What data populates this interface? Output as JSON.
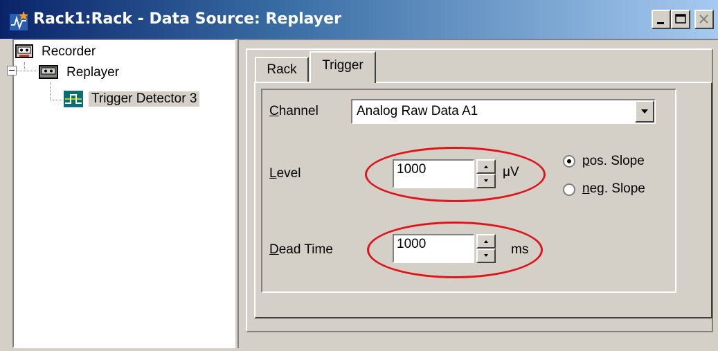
{
  "window": {
    "title": "Rack1:Rack - Data Source: Replayer",
    "controls": [
      "minimize-icon",
      "maximize-icon",
      "close-icon"
    ]
  },
  "tree": {
    "items": [
      {
        "label": "Recorder",
        "icon": "recorder-icon"
      },
      {
        "label": "Replayer",
        "icon": "replayer-icon"
      },
      {
        "label": "Trigger Detector 3",
        "icon": "trigger-detector-icon",
        "selected": true
      }
    ]
  },
  "tabs": [
    {
      "label": "Rack",
      "active": false
    },
    {
      "label": "Trigger",
      "active": true
    }
  ],
  "form": {
    "channel": {
      "label": "Channel",
      "accel": "C",
      "rest": "hannel",
      "value": "Analog Raw Data A1"
    },
    "level": {
      "label": "Level",
      "accel": "L",
      "rest": "evel",
      "value": "1000",
      "unit": "μV"
    },
    "dead_time": {
      "label": "Dead Time",
      "accel": "D",
      "rest": "ead Time",
      "value": "1000",
      "unit": "ms"
    },
    "slope": {
      "pos": {
        "label": "pos. Slope",
        "accel": "p",
        "rest": "os. Slope",
        "selected": true
      },
      "neg": {
        "label": "neg. Slope",
        "accel": "n",
        "rest": "eg. Slope",
        "selected": false
      }
    }
  },
  "colors": {
    "highlight_ellipse": "#e0151b",
    "title_gradient_start": "#0a246a",
    "title_gradient_end": "#a6caf0",
    "face": "#d4d0c8"
  }
}
